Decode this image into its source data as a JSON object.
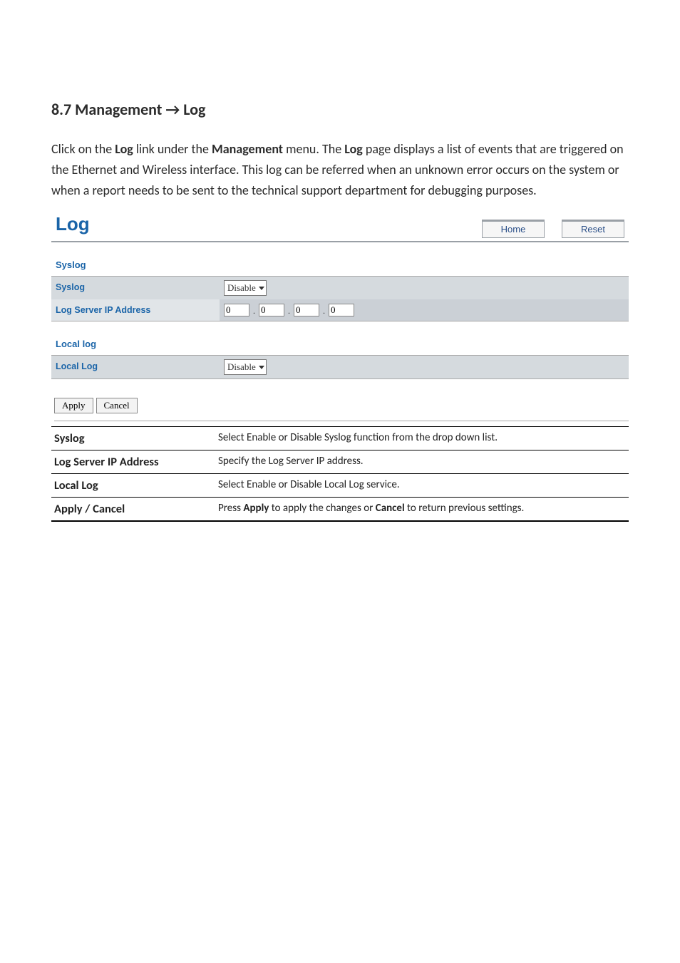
{
  "heading": "8.7 Management → Log",
  "intro": {
    "p1a": "Click on the ",
    "p1b": "Log",
    "p1c": " link under the ",
    "p1d": "Management",
    "p1e": " menu. The ",
    "p1f": "Log",
    "p1g": " page displays a list of events that are triggered on the Ethernet and Wireless interface. This log can be referred when an unknown error occurs on the system or when a report needs to be sent to the technical support department for debugging purposes."
  },
  "panel": {
    "title": "Log",
    "home": "Home",
    "reset": "Reset",
    "syslog_section": "Syslog",
    "syslog_label": "Syslog",
    "syslog_value": "Disable",
    "ip_label": "Log Server IP Address",
    "ip": {
      "a": "0",
      "b": "0",
      "c": "0",
      "d": "0"
    },
    "local_section": "Local log",
    "local_label": "Local Log",
    "local_value": "Disable",
    "apply": "Apply",
    "cancel": "Cancel"
  },
  "desc": {
    "r1l": "Syslog",
    "r1d": "Select Enable or Disable Syslog function from the drop down list.",
    "r2l": "Log Server IP Address",
    "r2d": "Specify the Log Server IP address.",
    "r3l": "Local Log",
    "r3d": "Select Enable or Disable Local Log service.",
    "r4l": "Apply / Cancel",
    "r4d_a": "Press ",
    "r4d_b": "Apply",
    "r4d_c": " to apply the changes or ",
    "r4d_d": "Cancel",
    "r4d_e": " to return previous settings."
  }
}
